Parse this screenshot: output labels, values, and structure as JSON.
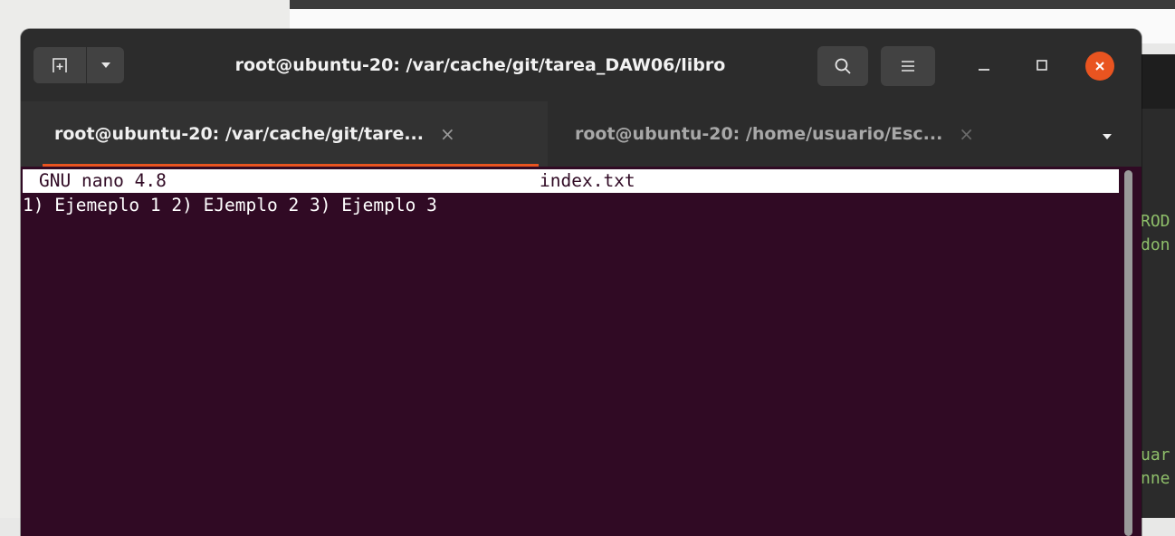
{
  "window": {
    "title": "root@ubuntu-20: /var/cache/git/tarea_DAW06/libro",
    "accent_color": "#e95420",
    "terminal_bg": "#300a24"
  },
  "titlebar_icons": {
    "new_tab": "new-tab-icon",
    "new_tab_dropdown": "chevron-down-icon",
    "search": "search-icon",
    "menu": "hamburger-menu-icon",
    "minimize": "minimize-icon",
    "maximize": "maximize-icon",
    "close": "close-icon"
  },
  "tabs": [
    {
      "label": "root@ubuntu-20: /var/cache/git/tare...",
      "close": "×",
      "active": true
    },
    {
      "label": "root@ubuntu-20: /home/usuario/Esc...",
      "close": "×",
      "active": false
    }
  ],
  "editor": {
    "header_left": "GNU nano 4.8",
    "header_file": "index.txt",
    "lines": [
      "1) Ejemeplo 1 2) EJemplo 2 3) Ejemplo 3"
    ]
  },
  "background_fragments": [
    "ROD",
    "don",
    "uar",
    "nne"
  ]
}
